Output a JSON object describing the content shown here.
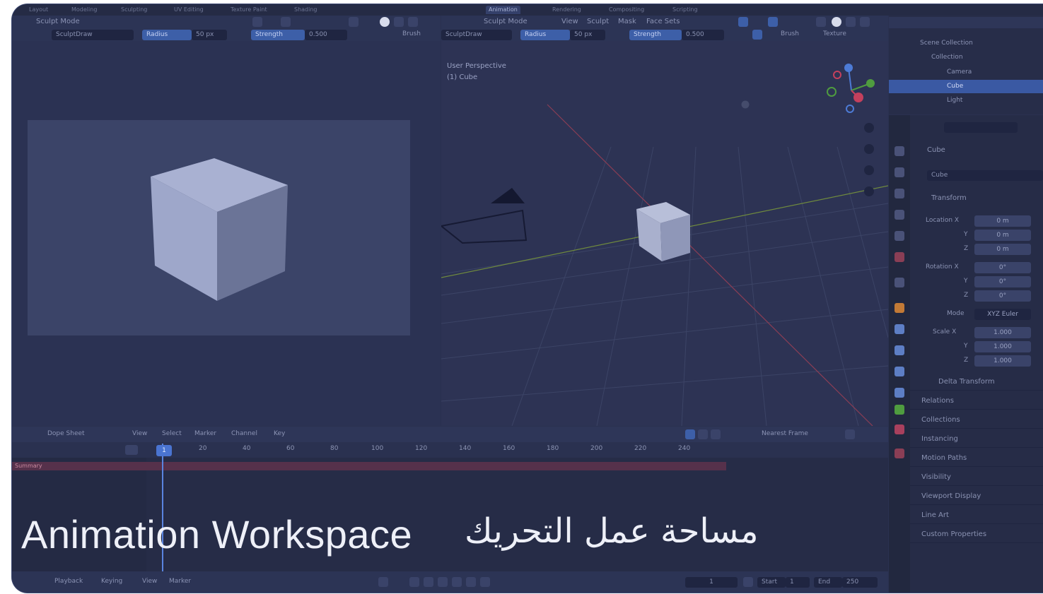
{
  "workspace_tabs": [
    "Layout",
    "Modeling",
    "Sculpting",
    "UV Editing",
    "Texture Paint",
    "Shading",
    "Animation",
    "Rendering",
    "Compositing",
    "Scripting"
  ],
  "left_header": {
    "mode": "Sculpt Mode",
    "brush": "SculptDraw",
    "radius_label": "Radius",
    "radius_value": "50 px",
    "strength_label": "Strength",
    "strength_value": "0.500",
    "brush_menu": "Brush"
  },
  "main_header": {
    "mode": "Sculpt Mode",
    "menus": [
      "View",
      "Sculpt",
      "Mask",
      "Face Sets"
    ],
    "brush": "SculptDraw",
    "radius_label": "Radius",
    "radius_value": "50 px",
    "strength_label": "Strength",
    "strength_value": "0.500",
    "brush_menu": "Brush",
    "texture_menu": "Texture"
  },
  "viewport": {
    "perspective_label": "User Perspective",
    "object_label": "(1) Cube"
  },
  "outliner": {
    "root": "Scene Collection",
    "collection": "Collection",
    "items": [
      "Camera",
      "Cube",
      "Light"
    ],
    "selected": "Cube"
  },
  "properties": {
    "object_name": "Cube",
    "data_name": "Cube",
    "transform_label": "Transform",
    "location_label": "Location X",
    "location": [
      "0 m",
      "0 m",
      "0 m"
    ],
    "rotation_label": "Rotation X",
    "rotation": [
      "0°",
      "0°",
      "0°"
    ],
    "mode_label": "Mode",
    "mode_value": "XYZ Euler",
    "scale_label": "Scale X",
    "scale": [
      "1.000",
      "1.000",
      "1.000"
    ],
    "axis_y": "Y",
    "axis_z": "Z",
    "panels": [
      "Delta Transform",
      "Relations",
      "Collections",
      "Instancing",
      "Motion Paths",
      "Visibility",
      "Viewport Display",
      "Line Art",
      "Custom Properties"
    ]
  },
  "dopesheet": {
    "editor_type": "Dope Sheet",
    "menus": [
      "View",
      "Select",
      "Marker",
      "Channel",
      "Key"
    ],
    "interpolation": "Nearest Frame",
    "current_frame": "1",
    "ticks": [
      "20",
      "40",
      "60",
      "80",
      "100",
      "120",
      "140",
      "160",
      "180",
      "200",
      "220",
      "240"
    ],
    "summary_label": "Summary"
  },
  "timeline": {
    "menus": [
      "Playback",
      "Keying",
      "View",
      "Marker"
    ],
    "frame": "1",
    "start_label": "Start",
    "start_value": "1",
    "end_label": "End",
    "end_value": "250"
  },
  "caption": {
    "english": "Animation Workspace",
    "arabic": "مساحة عمل التحريك"
  },
  "colors": {
    "accent_blue": "#3d5fa8",
    "selection": "#3a59a3",
    "background": "#2a3150",
    "summary_row": "#56314b"
  }
}
